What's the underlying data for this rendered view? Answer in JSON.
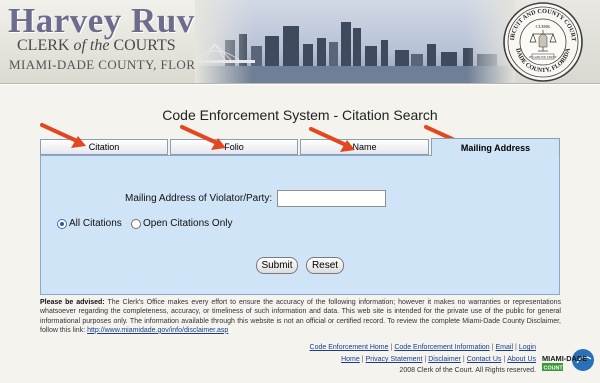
{
  "banner": {
    "name": "Harvey Ruvin",
    "subtitle_prefix": "CLERK ",
    "subtitle_italic": "of the",
    "subtitle_suffix": " COURTS",
    "county": "MIAMI-DADE COUNTY, FLORIDA",
    "seal": {
      "top_text": "CIRCUIT AND COUNTY COURTS",
      "bottom_text": "DADE COUNTY, FLORIDA",
      "center_top": "CLERK",
      "center_bottom": "IN GOD WE TRUST"
    }
  },
  "page_title": "Code Enforcement System - Citation Search",
  "tabs": [
    {
      "label": "Citation",
      "active": false
    },
    {
      "label": "Folio",
      "active": false
    },
    {
      "label": "Name",
      "active": false
    },
    {
      "label": "Mailing Address",
      "active": true
    }
  ],
  "form": {
    "address_label": "Mailing Address of Violator/Party:",
    "address_value": "",
    "radio_options": [
      {
        "label": "All Citations",
        "checked": true
      },
      {
        "label": "Open Citations Only",
        "checked": false
      }
    ],
    "submit_label": "Submit",
    "reset_label": "Reset"
  },
  "disclaimer": {
    "lead": "Please be advised:",
    "body": " The Clerk's Office makes every effort to ensure the accuracy of the following information; however it makes no warranties or representations whatsoever regarding the completeness, accuracy, or timeliness of such information and data. This web site is intended for the private use of the public for general informational purposes only. The information available through this website is not an official or certified record. To review the complete Miami-Dade County Disclaimer, follow this link: ",
    "link": "http://www.miamidade.gov/info/disclaimer.asp"
  },
  "footer": {
    "row1": [
      "Code Enforcement Home",
      "Code Enforcement Information",
      "Email",
      "Login"
    ],
    "row2": [
      "Home",
      "Privacy Statement",
      "Disclaimer",
      "Contact Us",
      "About Us"
    ],
    "copyright": "2008 Clerk of the Court. All Rights reserved.",
    "logo_top": "MIAMI-DADE",
    "logo_bottom": "COUNTY"
  },
  "colors": {
    "panel": "#cfe4f6",
    "arrow": "#e2481f",
    "link": "#1a3d8f",
    "brand": "#6c6c8f"
  }
}
